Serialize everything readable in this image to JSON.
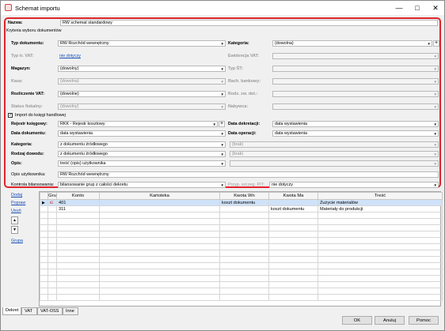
{
  "window": {
    "title": "Schemat importu"
  },
  "header": {
    "name_label": "Nazwa:",
    "name_value": "RW schemat standardowy",
    "criteria_section": "Kryteria wyboru dokumentów"
  },
  "criteria": {
    "typ_dok_label": "Typ dokumentu:",
    "typ_dok_value": "RW Rozchód wewnętrzny",
    "kategoria_label": "Kategoria:",
    "kategoria_value": "(dowolna)",
    "typ_vat_label": "Typ tr. VAT:",
    "typ_vat_value": "nie dotyczy",
    "ewid_vat_label": "Ewidencja VAT:",
    "magazyn_label": "Magazyn:",
    "magazyn_value": "(dowolny)",
    "typ_st_label": "Typ ŚT:",
    "kasa_label": "Kasa:",
    "kasa_value": "(dowolna)",
    "rach_label": "Rach. bankowy:",
    "rozl_vat_label": "Rozliczenie VAT:",
    "rozl_vat_value": "(dowolne)",
    "rodz_zw_label": "Rodz. zw. det.:",
    "status_label": "Status fiskalny:",
    "status_value": "(dowolny)",
    "nabywca_label": "Nabywca:",
    "plus": "+"
  },
  "import": {
    "checkbox_label": "Import do księgi handlowej",
    "checkmark": "✓",
    "rejestr_label": "Rejestr księgowy:",
    "rejestr_value": "RKK - Rejestr kosztowy",
    "data_dekr_label": "Data dekretacji:",
    "data_dekr_value": "data wystawienia",
    "data_dok_label": "Data dokumentu:",
    "data_dok_value": "data wystawienia",
    "data_op_label": "Data operacji:",
    "data_op_value": "data wystawienia",
    "kategoria_label": "Kategoria:",
    "kategoria_value": "z dokumentu źródłowego",
    "kategoria_right": "(brak)",
    "rodzaj_label": "Rodzaj dowodu:",
    "rodzaj_value": "z dokumentu źródłowego",
    "rodzaj_right": "(brak)",
    "opis_label": "Opis:",
    "opis_value": "treść (opis) użytkownika",
    "opis_uzyt_label": "Opis użytkownika:",
    "opis_uzyt_value": "RW Rozchód wewnętrzny",
    "kontrola_label": "Kontrola bilansowania:",
    "kontrola_value": "bilansowanie grup z całości dekretu",
    "przyp_label": "Przyp. szczeg. PIT:",
    "przyp_value": "nie dotyczy"
  },
  "grid": {
    "side_links": [
      "Dodaj",
      "Popraw",
      "Usuń",
      "Grupa"
    ],
    "up_arrow": "▲",
    "down_arrow": "▼",
    "headers": [
      "",
      "Gru",
      "Konto",
      "Kartoteka",
      "Kwota Wn",
      "Kwota Ma",
      "Treść"
    ],
    "rows": [
      {
        "marker": "▶",
        "grupa": "G",
        "konto": "401",
        "kartoteka": "",
        "wn": "koszt dokumentu",
        "ma": "",
        "tresc": "Zużycie materiałów"
      },
      {
        "marker": "",
        "grupa": "",
        "konto": "311",
        "kartoteka": "",
        "wn": "",
        "ma": "koszt dokumentu",
        "tresc": "Materiały do produkcji"
      }
    ]
  },
  "tabs": [
    "Dekret",
    "VAT",
    "VAT-OSS",
    "Inne"
  ],
  "buttons": {
    "ok": "OK",
    "cancel": "Anuluj",
    "help": "Pomoc"
  },
  "colors": {
    "highlight": "#e0242c",
    "selected_row": "#cfe2f8",
    "link": "#1a4fb8"
  }
}
